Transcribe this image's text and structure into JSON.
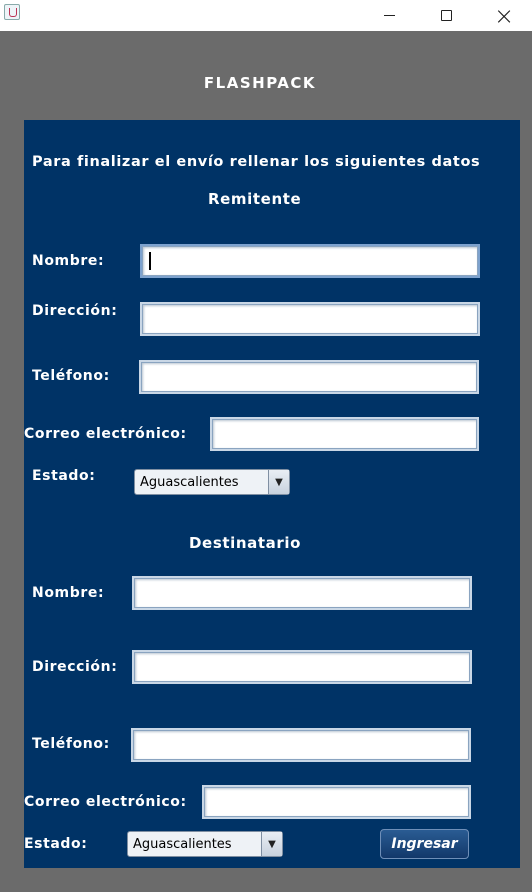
{
  "window": {
    "icon": "java-icon",
    "controls": {
      "minimize": "minimize-icon",
      "maximize": "maximize-icon",
      "close": "×"
    }
  },
  "app": {
    "title": "FLASHPACK"
  },
  "form": {
    "instructions": "Para finalizar el envío rellenar los siguientes datos",
    "sender": {
      "heading": "Remitente",
      "name_label": "Nombre:",
      "address_label": "Dirección:",
      "phone_label": "Teléfono:",
      "email_label": "Correo electrónico:",
      "state_label": "Estado:",
      "state_value": "Aguascalientes",
      "name_value": "",
      "address_value": "",
      "phone_value": "",
      "email_value": ""
    },
    "recipient": {
      "heading": "Destinatario",
      "name_label": "Nombre:",
      "address_label": "Dirección:",
      "phone_label": "Teléfono:",
      "email_label": "Correo electrónico:",
      "state_label": "Estado:",
      "state_value": "Aguascalientes",
      "name_value": "",
      "address_value": "",
      "phone_value": "",
      "email_value": ""
    },
    "submit_label": "Ingresar",
    "dropdown_arrow": "▼"
  },
  "colors": {
    "panel": "#003366",
    "background": "#6b6b6b",
    "text": "#ffffff"
  }
}
